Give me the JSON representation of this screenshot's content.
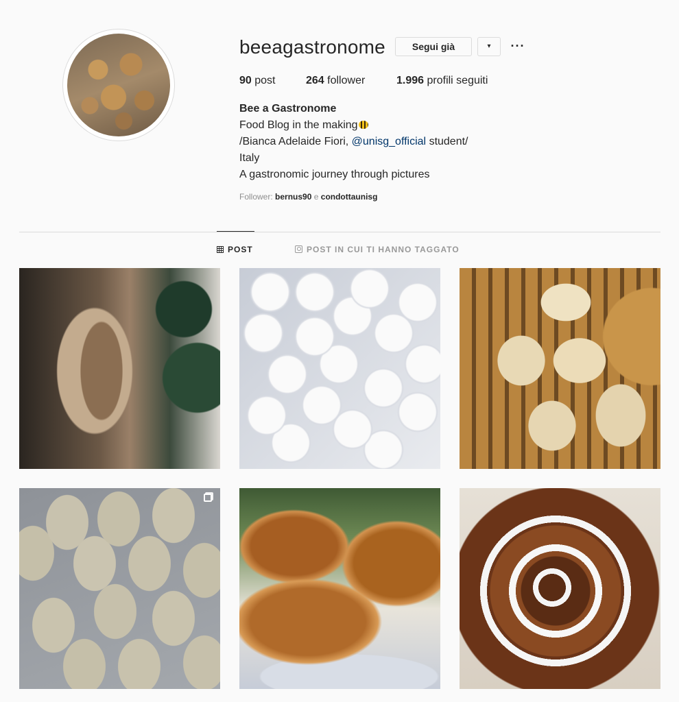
{
  "profile": {
    "username": "beeagastronome",
    "follow_button": "Segui già",
    "dropdown_icon": "▾",
    "more_icon": "···",
    "stats": {
      "posts_count": "90",
      "posts_label": "post",
      "followers_count": "264",
      "followers_label": "follower",
      "following_count": "1.996",
      "following_label": "profili seguiti"
    },
    "bio": {
      "name": "Bee a Gastronome",
      "line1": "Food Blog in the making",
      "line2_prefix": "/Bianca Adelaide Fiori,",
      "line2_link": "@unisg_official",
      "line2_suffix": "student/",
      "line3": "Italy",
      "line4": "A gastronomic journey through pictures"
    },
    "followed_by": {
      "label": "Follower:",
      "user1": "bernus90",
      "conjunction": "e",
      "user2": "condottaunisg"
    }
  },
  "tabs": {
    "posts": "POST",
    "tagged": "POST IN CUI TI HANNO TAGGATO"
  },
  "colors": {
    "background": "#fafafa",
    "text": "#262626",
    "link": "#003569",
    "muted": "#8e8e8e",
    "border": "#dbdbdb"
  }
}
